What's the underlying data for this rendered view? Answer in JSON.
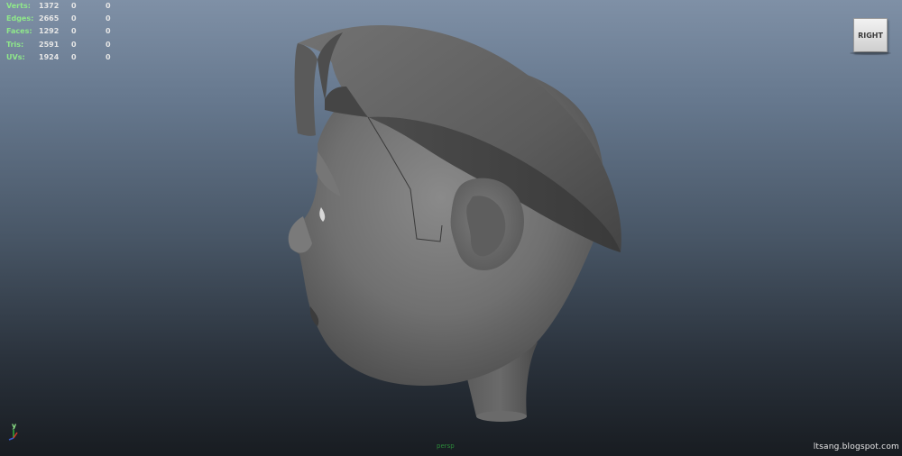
{
  "hud": {
    "rows": [
      {
        "label": "Verts:",
        "value": "1372",
        "selected": "0",
        "component": "0"
      },
      {
        "label": "Edges:",
        "value": "2665",
        "selected": "0",
        "component": "0"
      },
      {
        "label": "Faces:",
        "value": "1292",
        "selected": "0",
        "component": "0"
      },
      {
        "label": "Tris:",
        "value": "2591",
        "selected": "0",
        "component": "0"
      },
      {
        "label": "UVs:",
        "value": "1924",
        "selected": "0",
        "component": "0"
      }
    ]
  },
  "viewcube": {
    "label": "RIGHT"
  },
  "axis": {
    "y_label": "y"
  },
  "camera": {
    "label": "persp"
  },
  "watermark": "ltsang.blogspot.com",
  "colors": {
    "hud_label": "#8fe88a",
    "hud_value": "#e6e6e6",
    "camera_label": "#2c8a3a",
    "model_base": "#6e6e6e"
  }
}
